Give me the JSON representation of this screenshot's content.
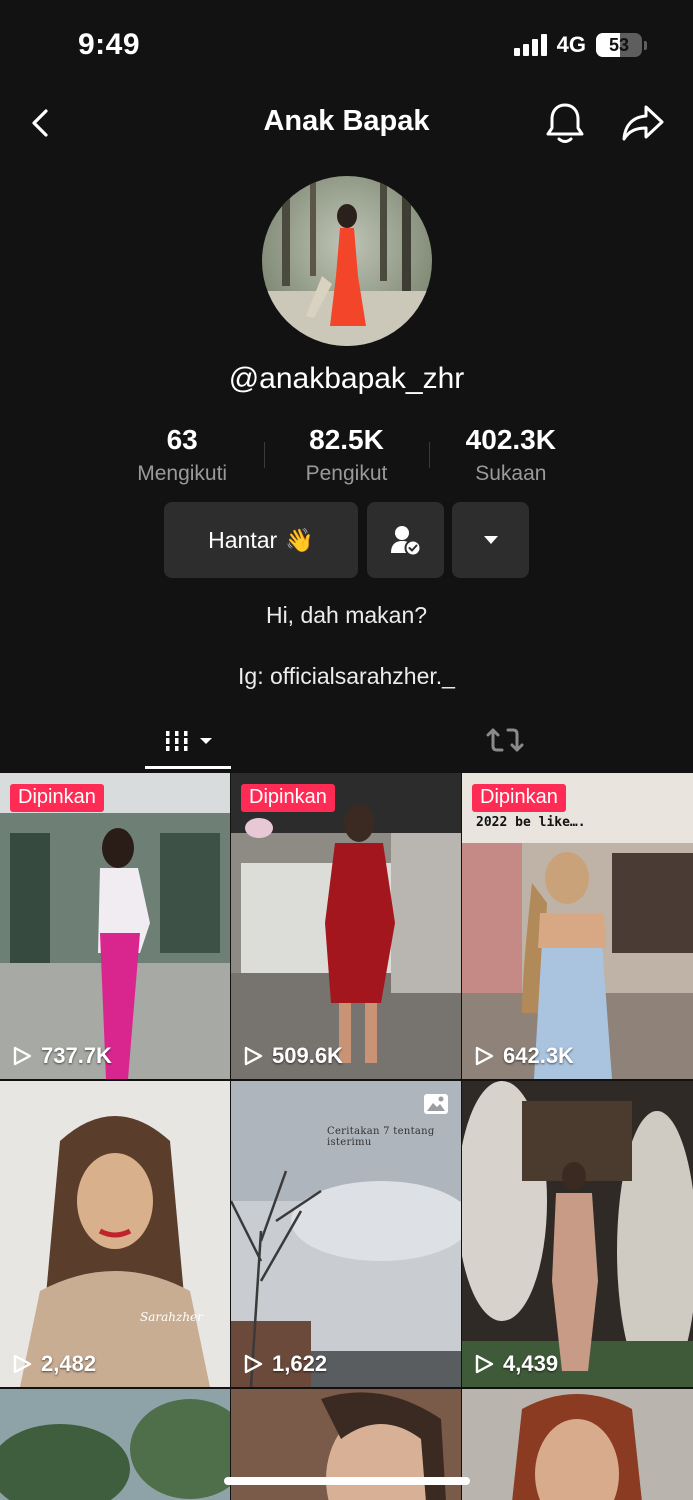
{
  "status_bar": {
    "time": "9:49",
    "network": "4G",
    "battery": "53",
    "battery_level": 0.53
  },
  "header": {
    "title": "Anak Bapak",
    "icons": [
      "back-icon",
      "bell-icon",
      "share-icon"
    ]
  },
  "profile": {
    "username": "@anakbapak_zhr",
    "stats": [
      {
        "value": "63",
        "label": "Mengikuti"
      },
      {
        "value": "82.5K",
        "label": "Pengikut"
      },
      {
        "value": "402.3K",
        "label": "Sukaan"
      }
    ],
    "actions": {
      "send_label": "Hantar",
      "send_emoji": "👋"
    },
    "bio": [
      "Hi, dah makan?",
      "Ig: officialsarahzher._"
    ]
  },
  "tabs": {
    "videos_icon": "grid-columns-icon",
    "repost_icon": "repost-icon"
  },
  "videos": [
    {
      "pinned": "Dipinkan",
      "views": "737.7K"
    },
    {
      "pinned": "Dipinkan",
      "views": "509.6K"
    },
    {
      "pinned": "Dipinkan",
      "views": "642.3K",
      "caption": "2022 be like…."
    },
    {
      "views": "2,482",
      "watermark": "Sarahzher"
    },
    {
      "views": "1,622",
      "caption": "Ceritakan 7 tentang isterimu"
    },
    {
      "views": "4,439"
    }
  ],
  "colors": {
    "background": "#121212",
    "button": "#2d2d2d",
    "pinned_badge": "#fe2c55",
    "muted_text": "#9a9a9a"
  }
}
